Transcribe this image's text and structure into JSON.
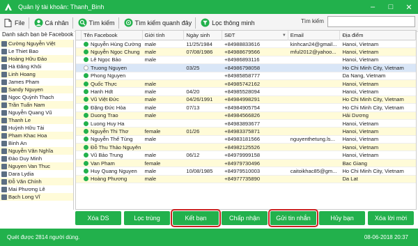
{
  "window": {
    "title": "Quản lý tài khoản: Thanh_Binh",
    "brand_color": "#22b14c"
  },
  "toolbar": {
    "file": "File",
    "personal": "Cá nhân",
    "search": "Tìm kiếm",
    "nearby": "Tìm kiếm quanh đây",
    "smart_filter": "Lọc thông minh",
    "search_label": "Tìm kiếm",
    "search_value": ""
  },
  "friends": {
    "header": "Danh sách bạn bè Facebook",
    "items": [
      "Cường Nguyễn Việt",
      "Le Thiet Bao",
      "Hoàng Hữu Đảo",
      "Hà Đăng Khôi",
      "Linh Hoang",
      "James Pham",
      "Sandy Nguyen",
      "Ngọc Quỳnh Thạch",
      "Trần Tuấn Nam",
      "Nguyễn Quang Vũ",
      "Thanh Le",
      "Huỳnh Hữu Tài",
      "Pham Khac Hoa",
      "Binh An",
      "Nguyễn Văn Nghĩa",
      "Đào Duy Minh",
      "Nguyen Van Thuc",
      "Dara Lydia",
      "Đỗ Văn Chính",
      "Mai Phương Lê",
      "Bạch Long Vĩ"
    ]
  },
  "grid": {
    "headers": [
      "Tên Facebook",
      "Giới tính",
      "Ngày sinh",
      "SĐT",
      "Email",
      "Địa điểm"
    ],
    "rows": [
      {
        "name": "Nguyễn Hùng Cường",
        "online": true,
        "gender": "male",
        "dob": "11/25/1984",
        "phone": "+84988833616",
        "email": "kinhcan24@gmail...",
        "place": "Hanoi, Vietnam"
      },
      {
        "name": "Nguyễn Ngọc Chung",
        "online": true,
        "gender": "male",
        "dob": "07/08/1986",
        "phone": "+84988679566",
        "email": "mful2012@yahoo...",
        "place": "Hanoi, Vietnam"
      },
      {
        "name": "Lê Ngọc Bảo",
        "online": true,
        "gender": "male",
        "dob": "",
        "phone": "+84986893116",
        "email": "",
        "place": "Hanoi, Vietnam"
      },
      {
        "name": "Truong Nguyen",
        "online": false,
        "gender": "",
        "dob": "03/25",
        "phone": "+84986798058",
        "email": "",
        "place": "Ho Chi Minh City, Vietnam"
      },
      {
        "name": "Phong Nguyen",
        "online": true,
        "gender": "",
        "dob": "",
        "phone": "+84985858777",
        "email": "",
        "place": "Da Nang, Vietnam"
      },
      {
        "name": "Quốc Thực",
        "online": true,
        "gender": "male",
        "dob": "",
        "phone": "+84985742162",
        "email": "",
        "place": "Hanoi, Vietnam"
      },
      {
        "name": "Hanh Hdt",
        "online": true,
        "gender": "male",
        "dob": "04/20",
        "phone": "+84985528094",
        "email": "",
        "place": "Hanoi, Vietnam"
      },
      {
        "name": "Vũ Việt Đức",
        "online": true,
        "gender": "male",
        "dob": "04/26/1991",
        "phone": "+84984998291",
        "email": "",
        "place": "Ho Chi Minh City, Vietnam"
      },
      {
        "name": "Đặng Đức Hòa",
        "online": true,
        "gender": "male",
        "dob": "07/13",
        "phone": "+84984905754",
        "email": "",
        "place": "Ho Chi Minh City, Vietnam"
      },
      {
        "name": "Duong Trao",
        "online": true,
        "gender": "male",
        "dob": "",
        "phone": "+84984566826",
        "email": "",
        "place": "Hải Dương"
      },
      {
        "name": "Luong Huy Ha",
        "online": true,
        "gender": "",
        "dob": "",
        "phone": "+84983893677",
        "email": "",
        "place": "Hanoi, Vietnam"
      },
      {
        "name": "Nguyễn Thi Thơ",
        "online": true,
        "gender": "female",
        "dob": "01/26",
        "phone": "+84983375871",
        "email": "",
        "place": "Hanoi, Vietnam"
      },
      {
        "name": "Nguyễn Thế Tùng",
        "online": true,
        "gender": "male",
        "dob": "",
        "phone": "+84983181566",
        "email": "nguyenthetung.ls...",
        "place": "Hanoi, Vietnam"
      },
      {
        "name": "Đỗ Thu Thảo Nguyên",
        "online": true,
        "gender": "",
        "dob": "",
        "phone": "+84982125526",
        "email": "",
        "place": "Hanoi, Vietnam"
      },
      {
        "name": "Vũ Bảo Trung",
        "online": true,
        "gender": "male",
        "dob": "06/12",
        "phone": "+84979999158",
        "email": "",
        "place": "Hanoi, Vietnam"
      },
      {
        "name": "Van Pham",
        "online": true,
        "gender": "female",
        "dob": "",
        "phone": "+84979730496",
        "email": "",
        "place": "Bac Giang"
      },
      {
        "name": "Huy Quang Nguyen",
        "online": true,
        "gender": "male",
        "dob": "10/08/1985",
        "phone": "+84979510003",
        "email": "caitoikhac85@gm...",
        "place": "Ho Chi Minh City, Vietnam"
      },
      {
        "name": "Hoàng Phương",
        "online": true,
        "gender": "male",
        "dob": "",
        "phone": "+84977735890",
        "email": "",
        "place": "Da Lat"
      }
    ]
  },
  "actions": {
    "delete_ds": "Xóa DS",
    "filter_dup": "Lọc trùng",
    "add_friend": "Kết bạn",
    "accept": "Chấp nhận",
    "send_msg": "Gửi tin nhắn",
    "unfriend": "Hủy bạn",
    "delete_invite": "Xóa lời mời"
  },
  "status": {
    "message": "Quét được 2814 người dùng.",
    "datetime": "08-06-2018 20:37"
  }
}
